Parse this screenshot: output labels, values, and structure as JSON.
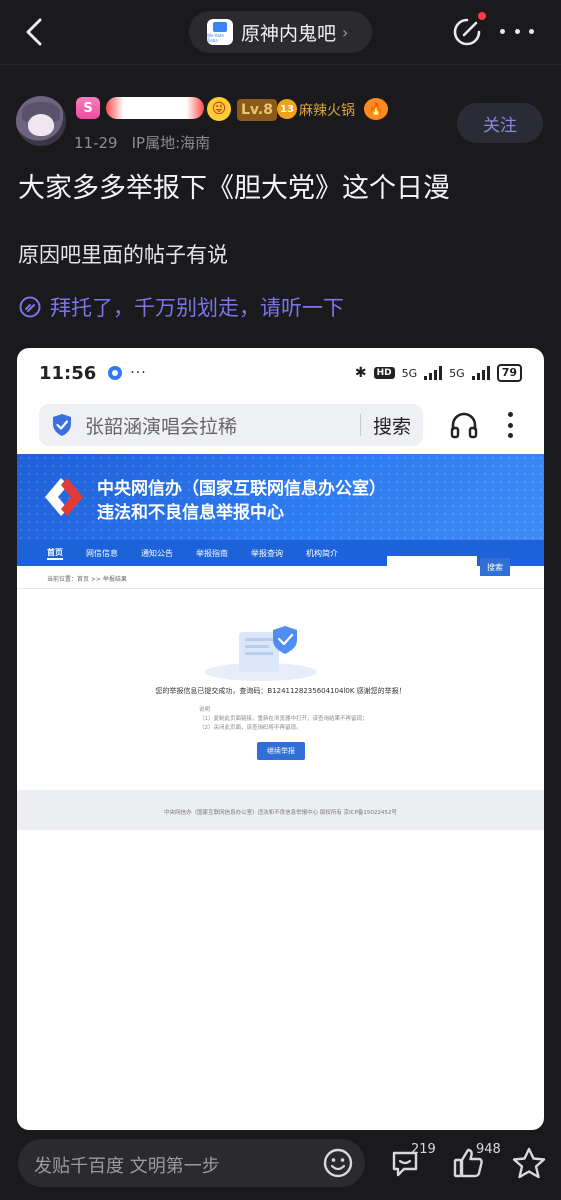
{
  "header": {
    "forum_name": "原神内鬼吧",
    "chevron": "›",
    "forum_logo_text": "We Hate Tieba"
  },
  "author": {
    "level": "Lv.8",
    "medal_number": "13",
    "title_tag": "麻辣火锅",
    "crown_text": "S",
    "date": "11-29",
    "ip_location": "IP属地:海南",
    "follow_label": "关注"
  },
  "post": {
    "title": "大家多多举报下《胆大党》这个日漫",
    "body": "原因吧里面的帖子有说",
    "link_text": "拜托了，千万别划走，请听一下"
  },
  "screenshot": {
    "status": {
      "time": "11:56",
      "ellipsis": "···",
      "bluetooth": "✱",
      "hd": "HD",
      "net1": "5G",
      "net2": "5G",
      "battery": "79"
    },
    "search": {
      "query": "张韶涵演唱会拉稀",
      "button": "搜索"
    },
    "banner": {
      "line1": "中央网信办（国家互联网信息办公室）",
      "line2": "违法和不良信息举报中心"
    },
    "nav": [
      "首页",
      "网信信息",
      "通知公告",
      "举报指南",
      "举报查询",
      "机构简介"
    ],
    "nav_search_button": "搜索",
    "breadcrumb": "当前位置：首页 >> 举报结果",
    "success_message": "您的举报信息已提交成功，查询码：B1241128235604104l0K 感谢您的举报！",
    "notes": {
      "heading": "说明",
      "line1": "（1）复制此页面链接，重新在浏览器中打开，该查询结果不再留现；",
      "line2": "（2）关闭此页面，该查询码将不再留现。"
    },
    "redo_button": "继续举报",
    "footer": "中央网信办（国家互联网信息办公室）违法和不良信息举报中心 版权所有 京ICP备15022452号"
  },
  "bottom": {
    "reply_placeholder": "发贴千百度 文明第一步",
    "comment_count": "219",
    "like_count": "948"
  },
  "colors": {
    "background": "#1a1a1c",
    "accent_purple": "#7f73e8",
    "banner_blue": "#2f7df2"
  }
}
